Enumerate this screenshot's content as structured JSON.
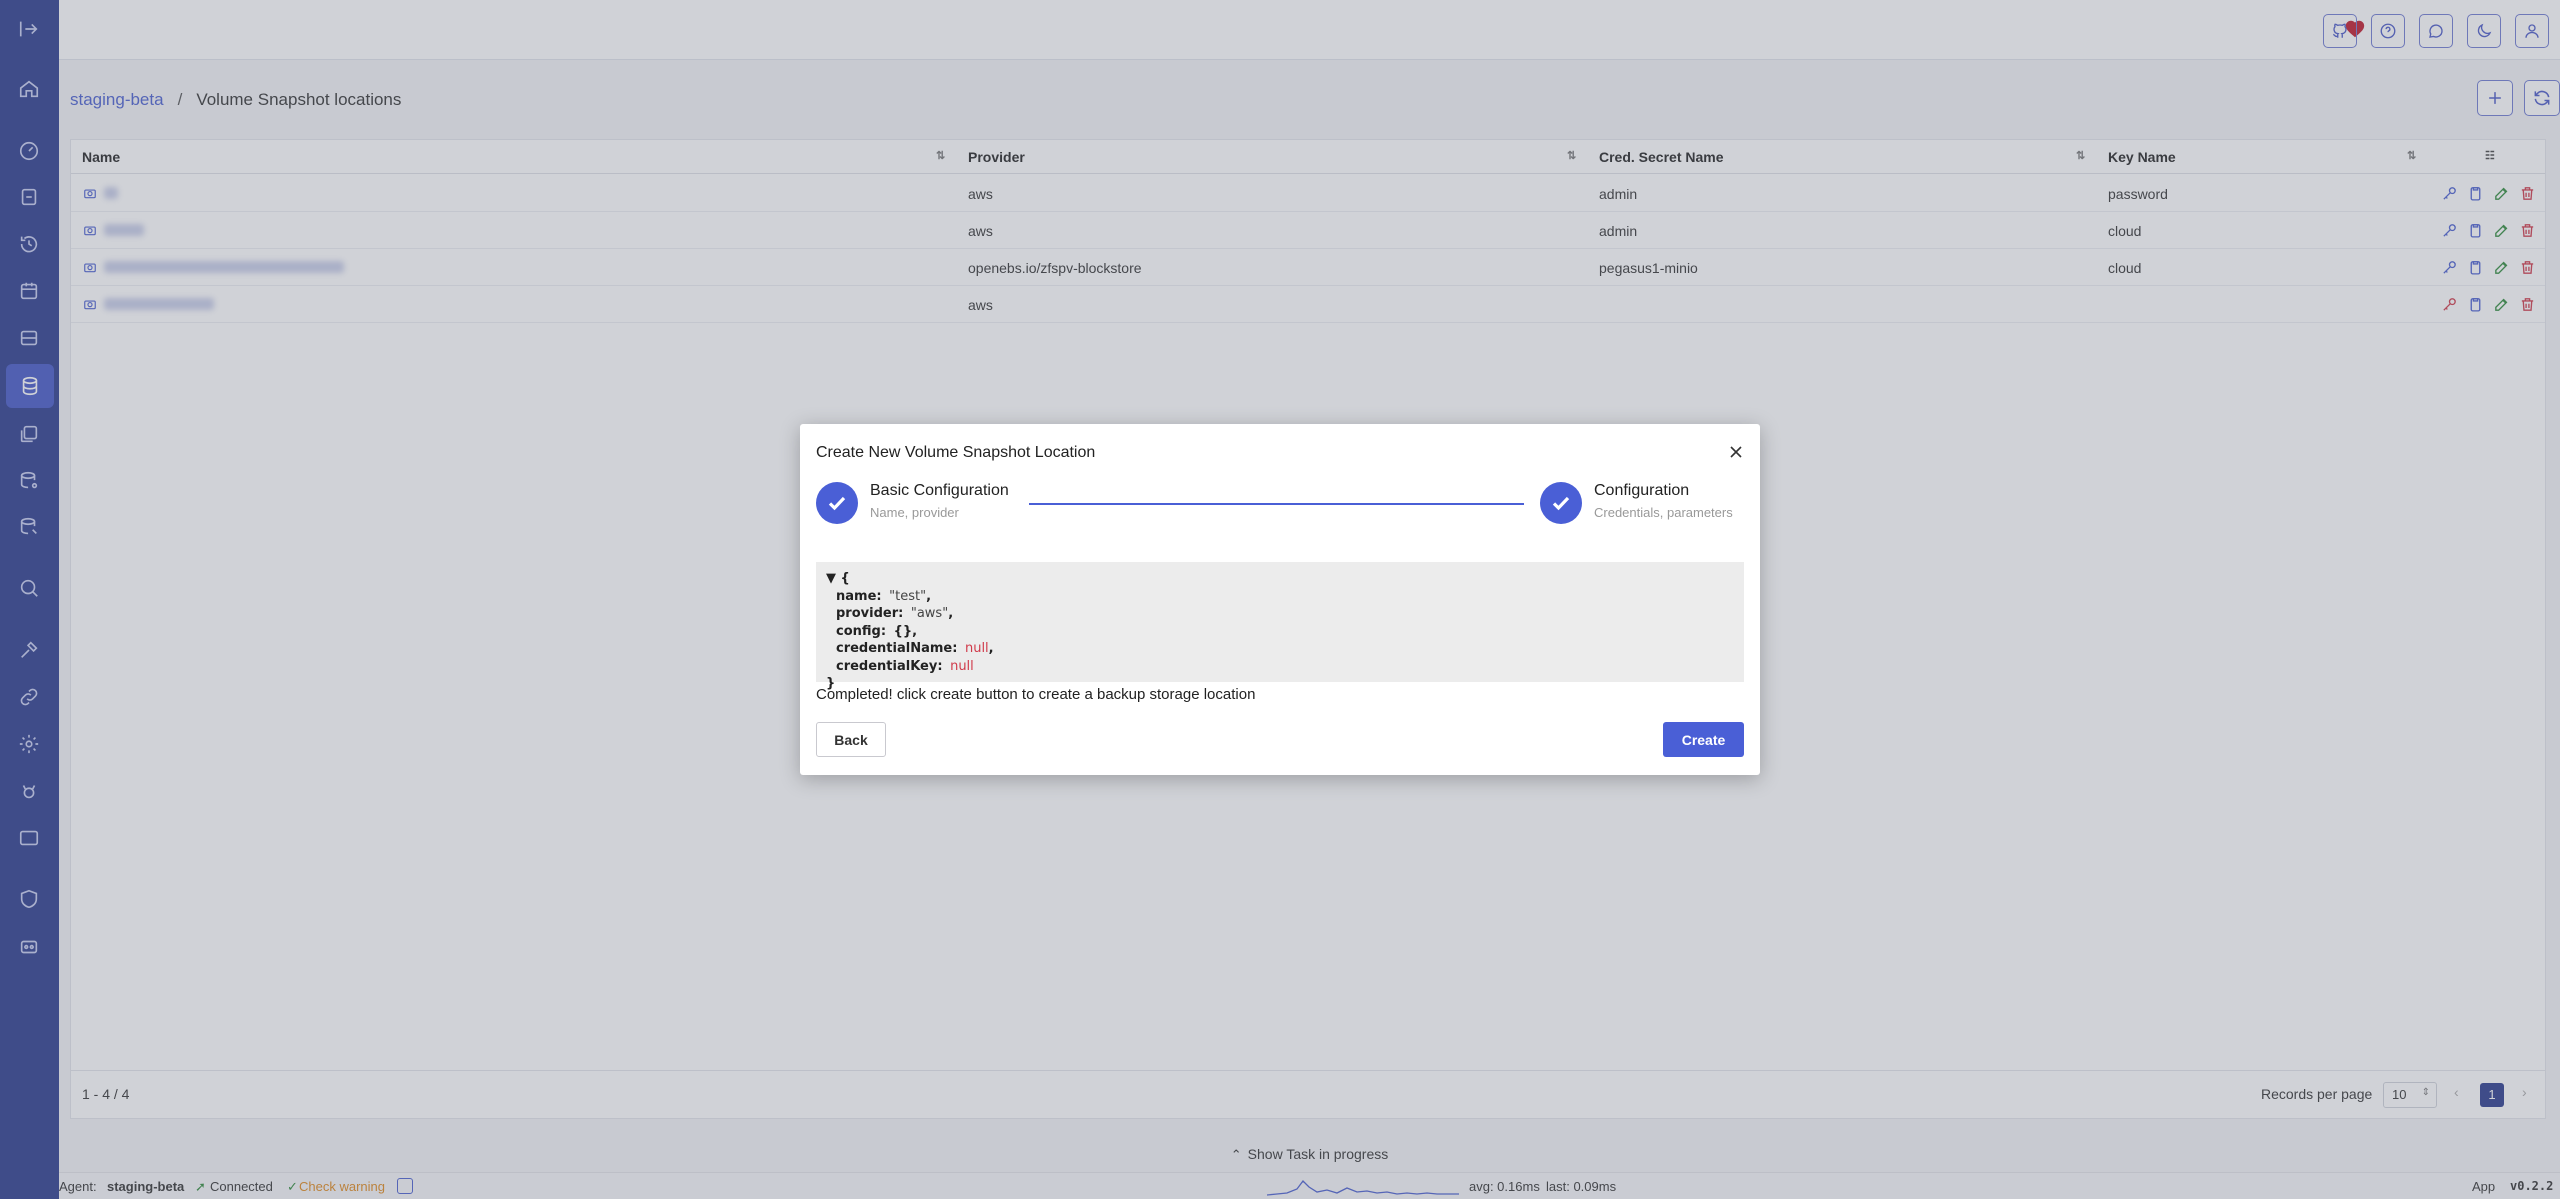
{
  "breadcrumb": {
    "cluster": "staging-beta",
    "separator": "/",
    "current": "Volume Snapshot locations"
  },
  "table": {
    "columns": [
      "Name",
      "Provider",
      "Cred. Secret Name",
      "Key Name"
    ],
    "rows": [
      {
        "provider": "aws",
        "secret": "admin",
        "key": "password"
      },
      {
        "provider": "aws",
        "secret": "admin",
        "key": "cloud"
      },
      {
        "provider": "openebs.io/zfspv-blockstore",
        "secret": "pegasus1-minio",
        "key": "cloud"
      },
      {
        "provider": "aws",
        "secret": "",
        "key": ""
      }
    ],
    "range": "1 - 4 / 4",
    "records_label": "Records per page",
    "records_value": "10",
    "page": "1"
  },
  "taskbar": {
    "label": "Show Task in progress"
  },
  "status": {
    "agent_label": "Agent:",
    "agent_name": "staging-beta",
    "connected": "Connected",
    "check_warning": "Check warning",
    "avg": "avg: 0.16ms",
    "last": "last: 0.09ms",
    "app": "App",
    "version": "v0.2.2"
  },
  "modal": {
    "title": "Create New Volume Snapshot Location",
    "step1_title": "Basic Configuration",
    "step1_sub": "Name, provider",
    "step2_title": "Configuration",
    "step2_sub": "Credentials, parameters",
    "json": {
      "open": "▼ {",
      "name_key": "name:",
      "name_val": "\"test\"",
      "provider_key": "provider:",
      "provider_val": "\"aws\"",
      "config_key": "config:",
      "config_val": "{},",
      "cred_name_key": "credentialName:",
      "cred_name_val": "null",
      "cred_key_key": "credentialKey:",
      "cred_key_val": "null",
      "close": "}"
    },
    "message": "Completed! click create button to create a backup storage location",
    "back_label": "Back",
    "create_label": "Create"
  },
  "colors": {
    "sidebar": "#2a3a8c",
    "accent": "#4a5fd6",
    "danger": "#d03a4a",
    "success": "#2e8b3a"
  }
}
